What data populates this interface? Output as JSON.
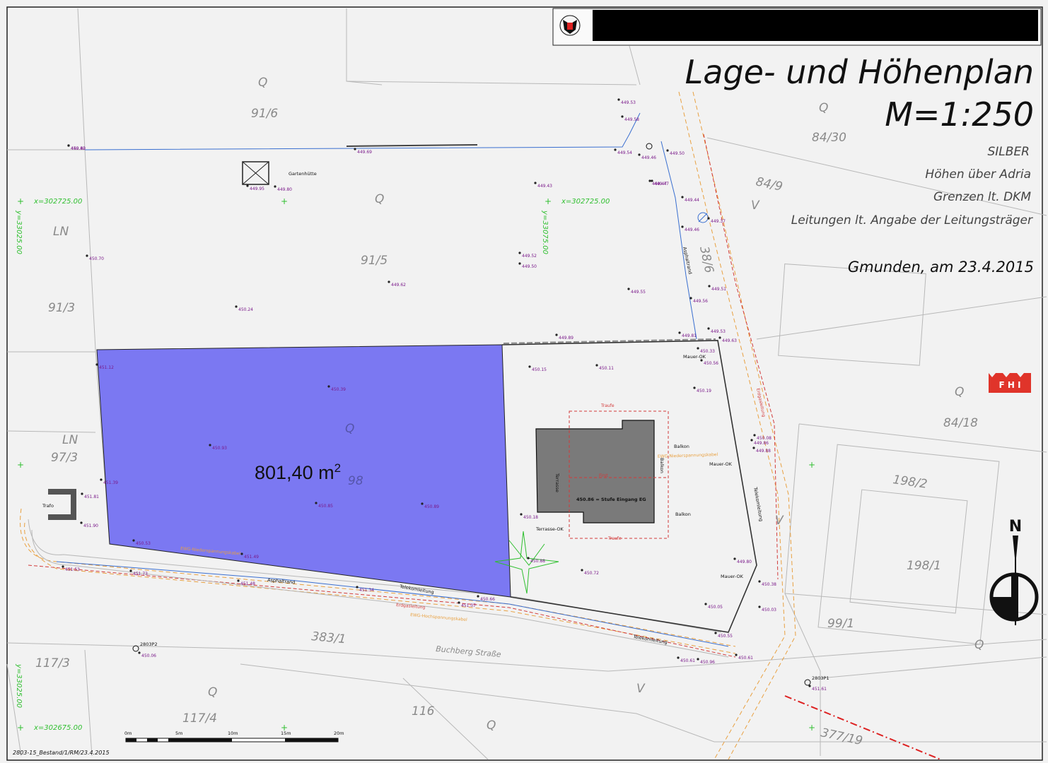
{
  "title": {
    "main": "Lage- und Höhenplan",
    "scale": "M=1:250"
  },
  "notes": [
    "SILBER",
    "Höhen über Adria",
    "Grenzen lt. DKM",
    "Leitungen lt. Angabe der Leitungsträger"
  ],
  "place_date": "Gmunden, am 23.4.2015",
  "footer": "2803-15_Bestand/1/RM/23.4.2015",
  "highlight": {
    "area_label": "801,40 m",
    "area_unit_sup": "2",
    "color": "#7b78f2"
  },
  "logo": {
    "text": "F H I",
    "color": "#e0342a"
  },
  "header_bar_color": "#000000",
  "parcels": [
    "91/6",
    "91/5",
    "91/3",
    "97/3",
    "98",
    "84/30",
    "84/9",
    "38/6",
    "84/18",
    "198/2",
    "198/1",
    "99/1",
    "383/1",
    "117/3",
    "117/4",
    "116",
    "377/19"
  ],
  "land_use": [
    "Q",
    "LN",
    "V"
  ],
  "street": "Buchberg Straße",
  "features": {
    "gartenhuette": "Gartenhütte",
    "trafo": "Trafo",
    "terrasse": "Terrasse",
    "balkon": "Balkon",
    "first": "First",
    "traufe": "Traufe",
    "stufe": "450.86 = Stufe Eingang EG",
    "terrasse_ok": "Terrasse-OK",
    "mauer_ok": "Mauer-OK",
    "asphaltrand": "Asphaltrand",
    "telekom": "Telekomleitung",
    "erdgas": "Erdgasleitung",
    "ewg_nieder": "EWG-Niederspannungskabel",
    "ewg_hoch": "EWG-Hochspannungskabel"
  },
  "coordinates": {
    "x1": "x=302725.00",
    "x2": "x=302725.00",
    "x3": "x=302675.00",
    "y1": "y=33025.00",
    "y2": "y=33075.00",
    "y3": "y=33025.00"
  },
  "points": {
    "p1": "2803P2",
    "p2": "2803P1"
  },
  "scalebar": [
    "0m",
    "5m",
    "10m",
    "15m",
    "20m"
  ],
  "north": "N",
  "heights": [
    "450.42",
    "449.69",
    "449.53",
    "449.58",
    "449.54",
    "449.46",
    "449.47",
    "449.50",
    "449.43",
    "449.47",
    "449.44",
    "449.37",
    "449.46",
    "449.52",
    "449.50",
    "449.62",
    "449.55",
    "449.51",
    "449.56",
    "449.53",
    "449.63",
    "449.81",
    "449.89",
    "450.70",
    "450.24",
    "449.95",
    "449.80",
    "451.12",
    "450.39",
    "450.93",
    "451.39",
    "450.85",
    "450.89",
    "451.81",
    "451.90",
    "450.53",
    "451.49",
    "451.53",
    "451.73",
    "451.48",
    "451.34",
    "451.07",
    "450.66",
    "450.33",
    "450.56",
    "450.15",
    "450.11",
    "450.19",
    "450.18",
    "450.88",
    "450.72",
    "450.05",
    "450.55",
    "450.61",
    "450.38",
    "450.03",
    "450.08",
    "449.86",
    "449.88",
    "449.80",
    "450.61",
    "450.96",
    "450.06",
    "451.61",
    "449.80"
  ]
}
